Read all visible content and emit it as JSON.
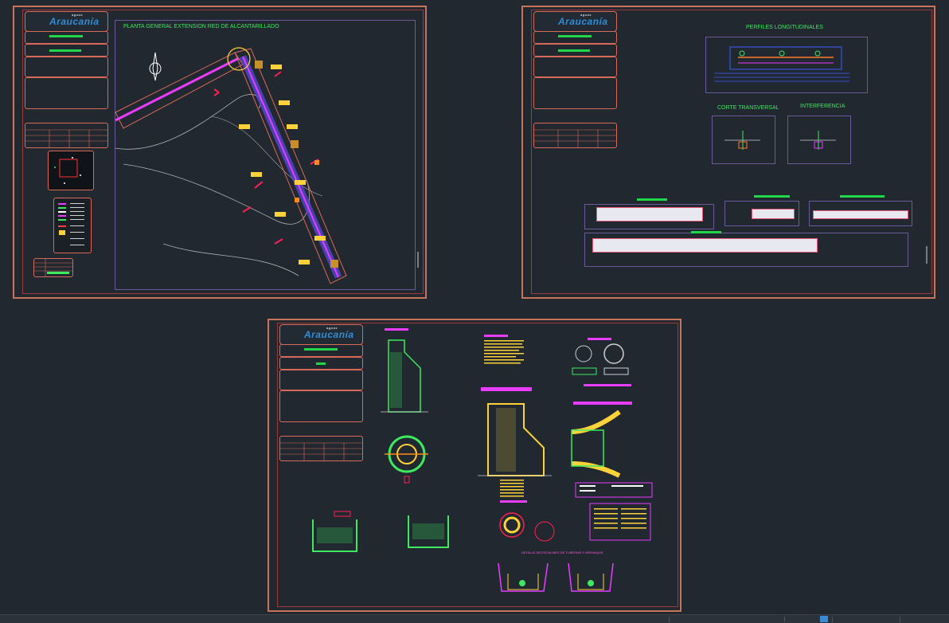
{
  "app": {
    "background": "#212830",
    "sheet_border_color": "#c9735a",
    "label_color": "#3ee85f"
  },
  "sheets": {
    "plan": {
      "viewport_title": "PLANTA GENERAL EXTENSION RED DE ALCANTARILLADO",
      "logo_text": "Araucanía",
      "logo_subtext": "aguas"
    },
    "profiles": {
      "logo_text": "Araucanía",
      "logo_subtext": "aguas",
      "profile_title": "PERFILES LONGITUDINALES",
      "cross_section_title": "CORTE TRANSVERSAL",
      "interference_title": "INTERFERENCIA"
    },
    "details": {
      "logo_text": "Araucanía",
      "logo_subtext": "aguas",
      "stairs_title": "DETALLE DE ESCALINES DE TUBERIAS Y ARRANQUE"
    }
  },
  "status_bar": {
    "items": [
      "",
      "",
      "",
      "",
      "",
      ""
    ],
    "coords_hint": ""
  },
  "icons": [
    "north-arrow-icon",
    "scroll-handle-icon"
  ]
}
